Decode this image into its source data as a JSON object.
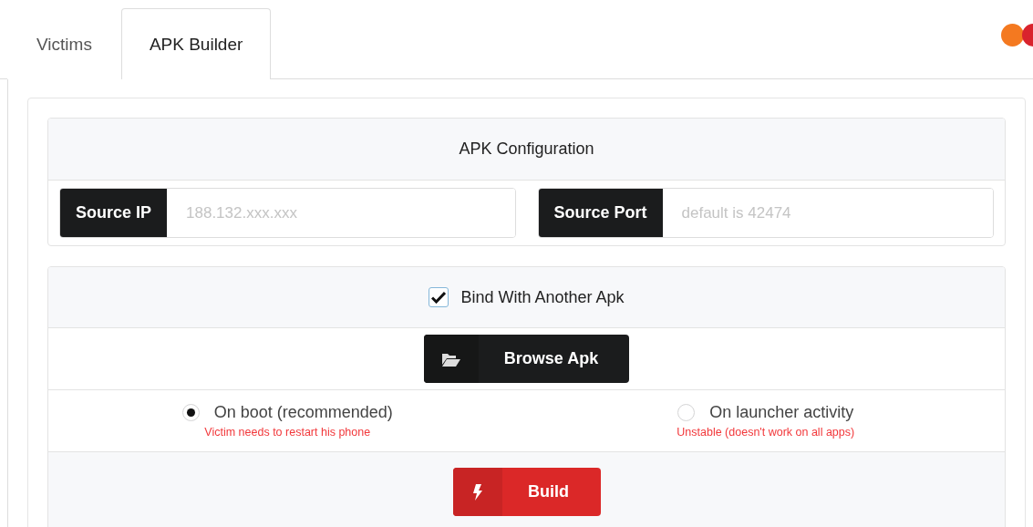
{
  "tabs": [
    {
      "label": "Victims",
      "selected": false
    },
    {
      "label": "APK Builder",
      "selected": true
    }
  ],
  "status_dots": [
    {
      "color": "#f47920"
    },
    {
      "color": "#d9232d"
    }
  ],
  "apk_configuration": {
    "title": "APK Configuration",
    "fields": [
      {
        "label": "Source IP",
        "placeholder": "188.132.xxx.xxx"
      },
      {
        "label": "Source Port",
        "placeholder": "default is 42474"
      }
    ]
  },
  "binding": {
    "checkbox": {
      "label": "Bind With Another Apk",
      "checked": true
    },
    "browse_button": "Browse Apk",
    "options": [
      {
        "label": "On boot (recommended)",
        "note": "Victim needs to restart his phone",
        "selected": true
      },
      {
        "label": "On launcher activity",
        "note": "Unstable (doesn't work on all apps)",
        "selected": false
      }
    ],
    "build_button": "Build"
  }
}
